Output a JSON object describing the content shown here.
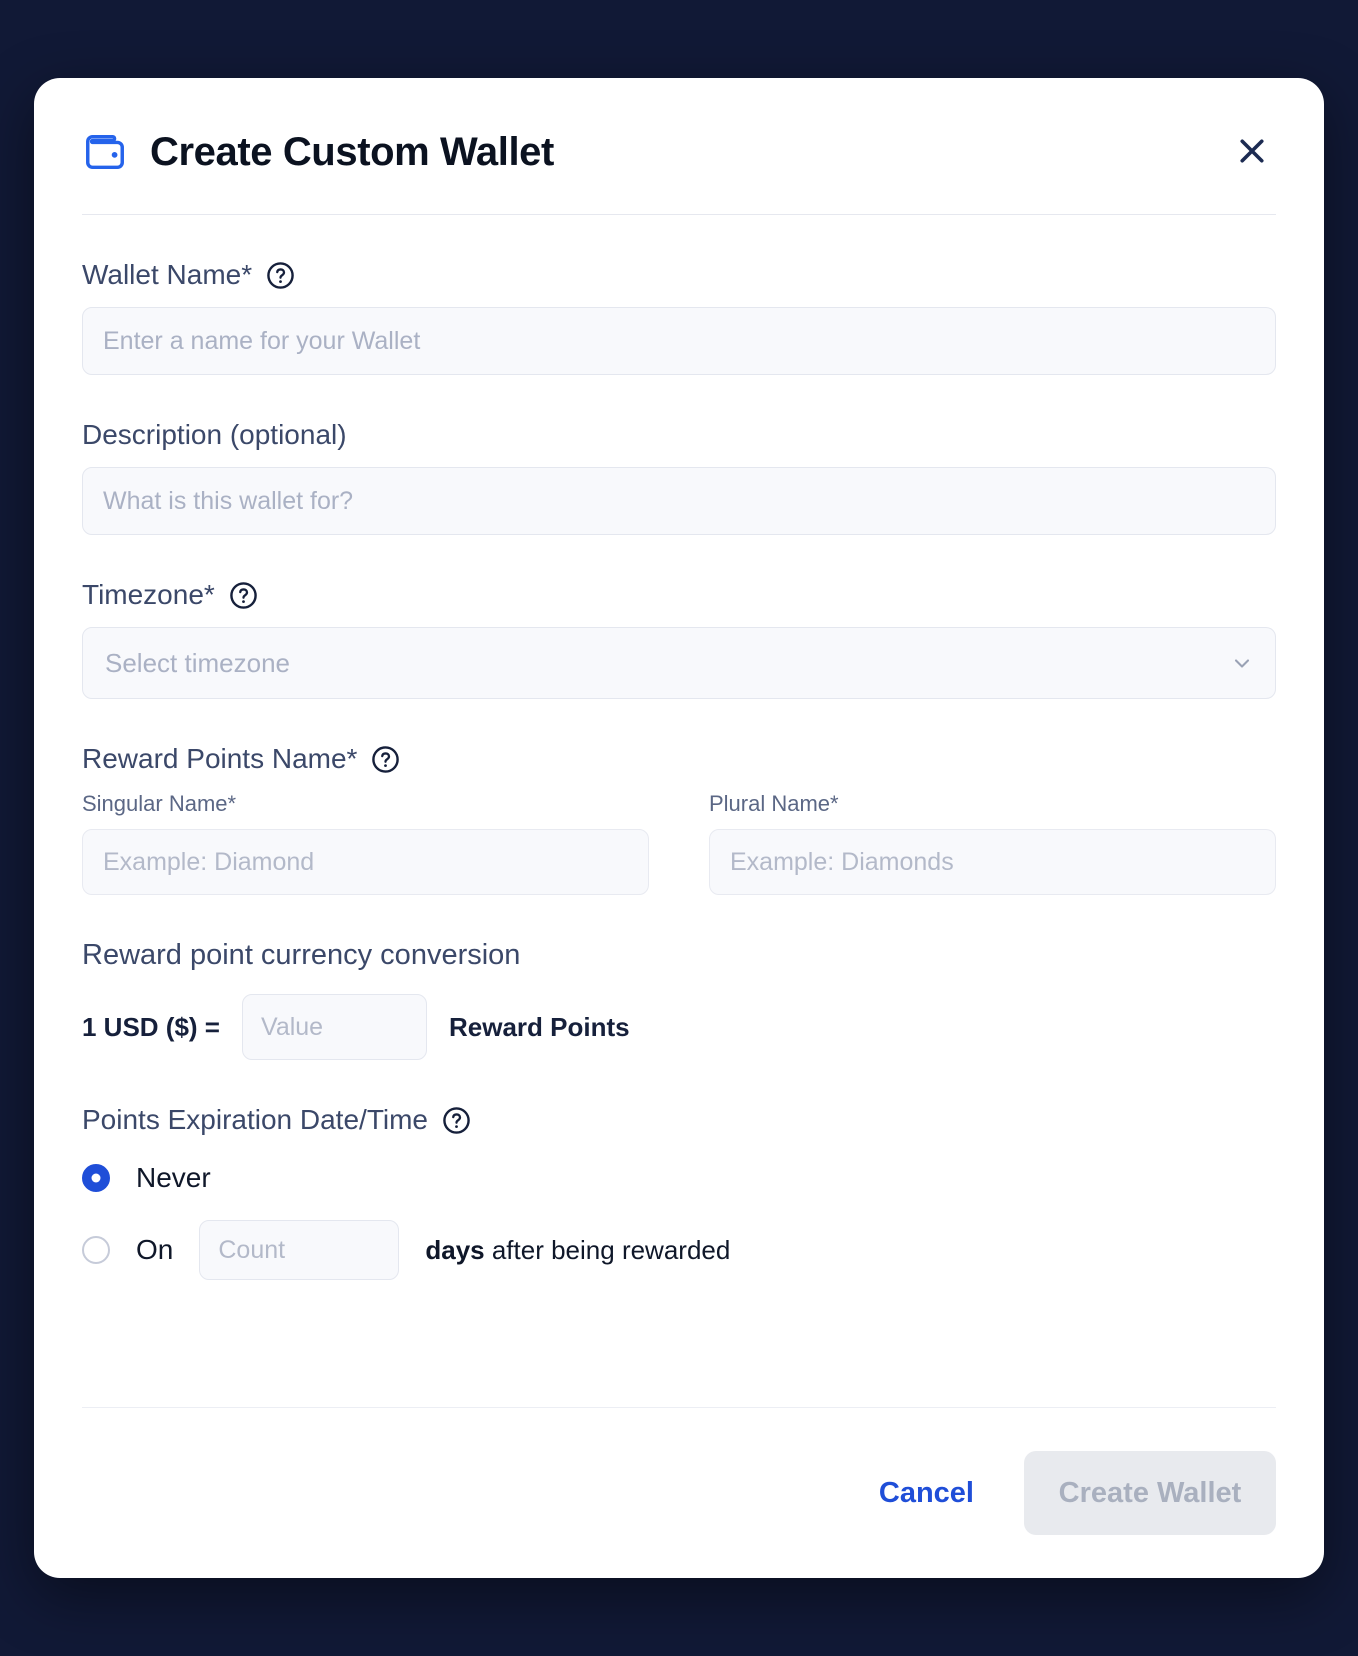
{
  "modal": {
    "title": "Create Custom Wallet",
    "icon": "wallet-icon",
    "close_icon": "close-icon"
  },
  "fields": {
    "wallet_name": {
      "label": "Wallet Name*",
      "help_icon": "help-circle-icon",
      "placeholder": "Enter a name for your Wallet",
      "value": ""
    },
    "description": {
      "label": "Description (optional)",
      "placeholder": "What is this wallet for?",
      "value": ""
    },
    "timezone": {
      "label": "Timezone*",
      "help_icon": "help-circle-icon",
      "placeholder": "Select timezone",
      "selected": "Select timezone",
      "chevron_icon": "chevron-down-icon"
    },
    "reward_points_name": {
      "label": "Reward Points Name*",
      "help_icon": "help-circle-icon",
      "singular": {
        "label": "Singular Name*",
        "placeholder": "Example: Diamond",
        "value": ""
      },
      "plural": {
        "label": "Plural Name*",
        "placeholder": "Example: Diamonds",
        "value": ""
      }
    },
    "conversion": {
      "title": "Reward point currency conversion",
      "prefix": "1 USD ($) =",
      "placeholder": "Value",
      "value": "",
      "suffix": "Reward Points"
    },
    "expiration": {
      "label": "Points Expiration Date/Time",
      "help_icon": "help-circle-icon",
      "options": [
        {
          "label": "Never",
          "selected": true
        },
        {
          "label": "On",
          "selected": false
        }
      ],
      "count_placeholder": "Count",
      "count_value": "",
      "days_bold": "days",
      "days_rest": " after being rewarded"
    }
  },
  "footer": {
    "cancel_label": "Cancel",
    "create_label": "Create Wallet"
  },
  "colors": {
    "accent_blue": "#1f4ed8",
    "label_navy": "#3b4869",
    "title_dark": "#0b1220",
    "input_bg": "#f8f9fc",
    "input_border": "#e4e7ef",
    "placeholder": "#aab1c4",
    "disabled_btn_bg": "#e8eaee",
    "disabled_btn_text": "#a9b0bf",
    "backdrop": "#111936"
  }
}
